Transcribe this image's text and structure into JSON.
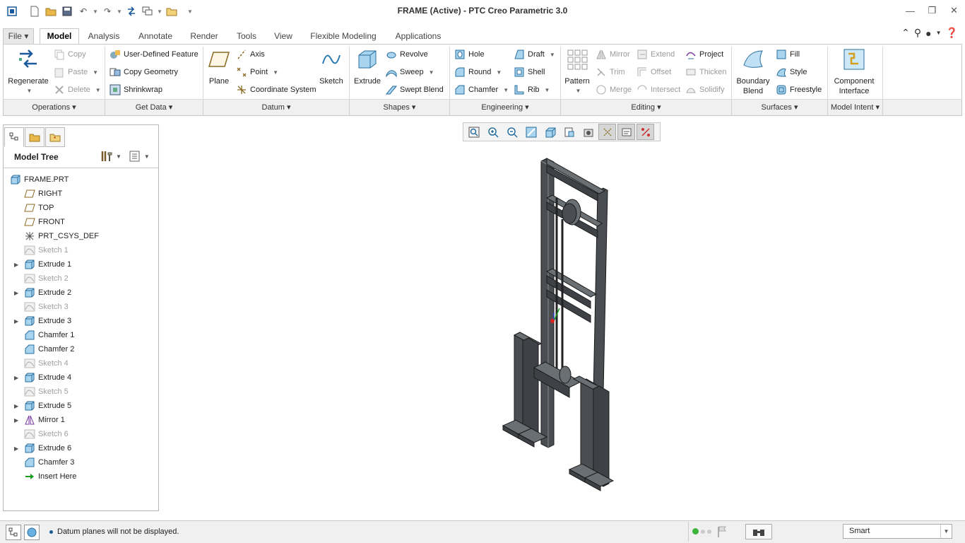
{
  "window": {
    "title": "FRAME (Active) - PTC Creo Parametric 3.0"
  },
  "tabs": [
    "File",
    "Model",
    "Analysis",
    "Annotate",
    "Render",
    "Tools",
    "View",
    "Flexible Modeling",
    "Applications"
  ],
  "ribbon": {
    "operations": {
      "regenerate": "Regenerate",
      "copy": "Copy",
      "paste": "Paste",
      "delete": "Delete"
    },
    "get_data": {
      "udf": "User-Defined Feature",
      "copy_geometry": "Copy Geometry",
      "shrinkwrap": "Shrinkwrap"
    },
    "datum": {
      "plane": "Plane",
      "axis": "Axis",
      "point": "Point",
      "csys": "Coordinate System",
      "sketch": "Sketch"
    },
    "shapes": {
      "extrude": "Extrude",
      "revolve": "Revolve",
      "sweep": "Sweep",
      "swept_blend": "Swept Blend"
    },
    "engineering": {
      "hole": "Hole",
      "round": "Round",
      "chamfer": "Chamfer",
      "draft": "Draft",
      "shell": "Shell",
      "rib": "Rib"
    },
    "editing": {
      "pattern": "Pattern",
      "mirror": "Mirror",
      "trim": "Trim",
      "merge": "Merge",
      "extend": "Extend",
      "offset": "Offset",
      "intersect": "Intersect",
      "project": "Project",
      "thicken": "Thicken",
      "solidify": "Solidify"
    },
    "surfaces": {
      "boundary_blend_1": "Boundary",
      "boundary_blend_2": "Blend",
      "fill": "Fill",
      "style": "Style",
      "freestyle": "Freestyle"
    },
    "model_intent": {
      "component_1": "Component",
      "component_2": "Interface"
    }
  },
  "groups": [
    "Operations",
    "Get Data",
    "Datum",
    "Shapes",
    "Engineering",
    "Editing",
    "Surfaces",
    "Model Intent"
  ],
  "model_tree": {
    "title": "Model Tree",
    "items": [
      {
        "label": "FRAME.PRT",
        "icon": "part",
        "expand": false,
        "dim": false,
        "indent": 0
      },
      {
        "label": "RIGHT",
        "icon": "plane",
        "expand": false,
        "dim": false,
        "indent": 1
      },
      {
        "label": "TOP",
        "icon": "plane",
        "expand": false,
        "dim": false,
        "indent": 1
      },
      {
        "label": "FRONT",
        "icon": "plane",
        "expand": false,
        "dim": false,
        "indent": 1
      },
      {
        "label": "PRT_CSYS_DEF",
        "icon": "csys",
        "expand": false,
        "dim": false,
        "indent": 1
      },
      {
        "label": "Sketch 1",
        "icon": "sketch",
        "expand": false,
        "dim": true,
        "indent": 1
      },
      {
        "label": "Extrude 1",
        "icon": "extrude",
        "expand": true,
        "dim": false,
        "indent": 1
      },
      {
        "label": "Sketch 2",
        "icon": "sketch",
        "expand": false,
        "dim": true,
        "indent": 1
      },
      {
        "label": "Extrude 2",
        "icon": "extrude",
        "expand": true,
        "dim": false,
        "indent": 1
      },
      {
        "label": "Sketch 3",
        "icon": "sketch",
        "expand": false,
        "dim": true,
        "indent": 1
      },
      {
        "label": "Extrude 3",
        "icon": "extrude",
        "expand": true,
        "dim": false,
        "indent": 1
      },
      {
        "label": "Chamfer 1",
        "icon": "chamfer",
        "expand": false,
        "dim": false,
        "indent": 1
      },
      {
        "label": "Chamfer 2",
        "icon": "chamfer",
        "expand": false,
        "dim": false,
        "indent": 1
      },
      {
        "label": "Sketch 4",
        "icon": "sketch",
        "expand": false,
        "dim": true,
        "indent": 1
      },
      {
        "label": "Extrude 4",
        "icon": "extrude",
        "expand": true,
        "dim": false,
        "indent": 1
      },
      {
        "label": "Sketch 5",
        "icon": "sketch",
        "expand": false,
        "dim": true,
        "indent": 1
      },
      {
        "label": "Extrude 5",
        "icon": "extrude",
        "expand": true,
        "dim": false,
        "indent": 1
      },
      {
        "label": "Mirror 1",
        "icon": "mirror",
        "expand": true,
        "dim": false,
        "indent": 1
      },
      {
        "label": "Sketch 6",
        "icon": "sketch",
        "expand": false,
        "dim": true,
        "indent": 1
      },
      {
        "label": "Extrude 6",
        "icon": "extrude",
        "expand": true,
        "dim": false,
        "indent": 1
      },
      {
        "label": "Chamfer 3",
        "icon": "chamfer",
        "expand": false,
        "dim": false,
        "indent": 1
      },
      {
        "label": "Insert Here",
        "icon": "insert",
        "expand": false,
        "dim": false,
        "indent": 1
      }
    ]
  },
  "status": {
    "message": "Datum planes will not be displayed.",
    "filter": "Smart"
  }
}
